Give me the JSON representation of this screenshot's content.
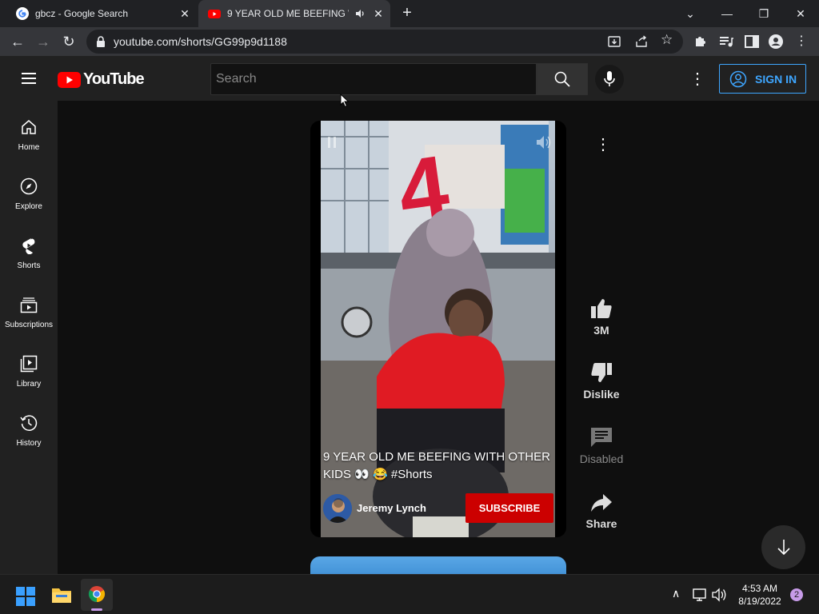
{
  "browser": {
    "tabs": [
      {
        "title": "gbcz - Google Search",
        "active": false
      },
      {
        "title": "9 YEAR OLD ME BEEFING WI",
        "active": true
      }
    ],
    "url": "youtube.com/shorts/GG99p9d1188"
  },
  "youtube": {
    "logo_text": "YouTube",
    "search_placeholder": "Search",
    "sign_in_label": "SIGN IN",
    "sidebar": [
      {
        "label": "Home",
        "icon": "home-icon"
      },
      {
        "label": "Explore",
        "icon": "compass-icon"
      },
      {
        "label": "Shorts",
        "icon": "shorts-icon"
      },
      {
        "label": "Subscriptions",
        "icon": "subscriptions-icon"
      },
      {
        "label": "Library",
        "icon": "library-icon"
      },
      {
        "label": "History",
        "icon": "history-icon"
      }
    ],
    "short": {
      "title": "9 YEAR OLD ME BEEFING WITH OTHER KIDS 👀 😂 #Shorts",
      "channel": "Jeremy Lynch",
      "subscribe_label": "SUBSCRIBE",
      "likes": "3M",
      "dislike_label": "Dislike",
      "comments_label": "Disabled",
      "share_label": "Share"
    },
    "colors": {
      "brand_red": "#ff0000",
      "subscribe_red": "#cc0000",
      "signin_blue": "#3ea6ff"
    }
  },
  "taskbar": {
    "time": "4:53 AM",
    "date": "8/19/2022",
    "notification_count": "2"
  }
}
